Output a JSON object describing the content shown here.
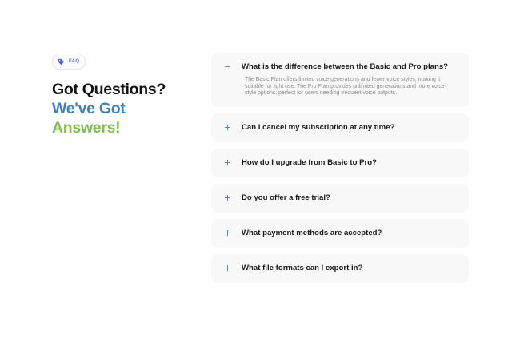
{
  "badge": {
    "label": "FAQ",
    "icon": "tag-icon"
  },
  "heading": {
    "line1": "Got Questions?",
    "line2": "We've Got",
    "line3": "Answers!"
  },
  "colors": {
    "accent_blue": "#3b82c4",
    "accent_green": "#7fbf4d",
    "toggle": "#5b86b8"
  },
  "faq": [
    {
      "question": "What is the difference between the Basic and Pro plans?",
      "answer": "The Basic Plan offers limited voice generations and fewer voice styles, making it suitable for light use. The Pro Plan provides unlimited generations and more voice style options, perfect for users needing frequent voice outputs.",
      "expanded": true
    },
    {
      "question": "Can I cancel my subscription at any time?",
      "expanded": false
    },
    {
      "question": "How do I upgrade from Basic to Pro?",
      "expanded": false
    },
    {
      "question": "Do you offer a free trial?",
      "expanded": false
    },
    {
      "question": "What payment methods are accepted?",
      "expanded": false
    },
    {
      "question": "What file formats can I export in?",
      "expanded": false
    }
  ]
}
